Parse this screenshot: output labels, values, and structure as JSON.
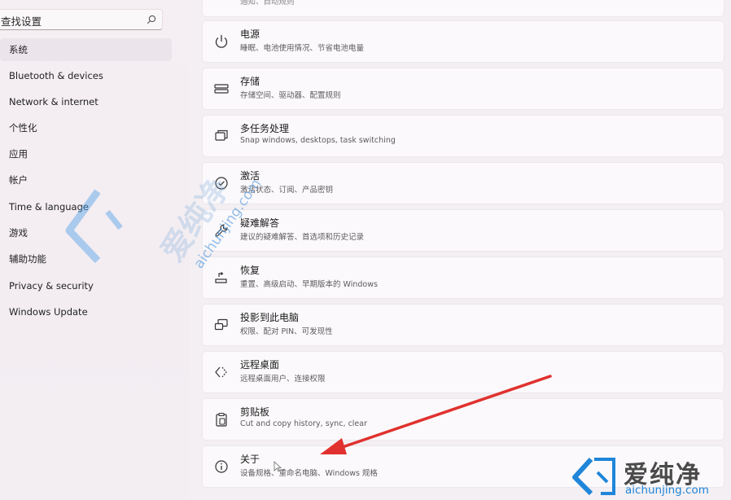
{
  "search": {
    "placeholder": "查找设置"
  },
  "sidebar": {
    "items": [
      {
        "label": "系统",
        "active": true
      },
      {
        "label": "Bluetooth & devices"
      },
      {
        "label": "Network & internet"
      },
      {
        "label": "个性化"
      },
      {
        "label": "应用"
      },
      {
        "label": "帐户"
      },
      {
        "label": "Time & language"
      },
      {
        "label": "游戏"
      },
      {
        "label": "辅助功能"
      },
      {
        "label": "Privacy & security"
      },
      {
        "label": "Windows Update"
      }
    ]
  },
  "main": {
    "top_partial": {
      "desc": "通知、自动规则"
    },
    "cards": [
      {
        "icon": "power-icon",
        "title": "电源",
        "desc": "睡眠、电池使用情况、节省电池电量"
      },
      {
        "icon": "storage-icon",
        "title": "存储",
        "desc": "存储空间、驱动器、配置规则"
      },
      {
        "icon": "multitasking-icon",
        "title": "多任务处理",
        "desc": "Snap windows, desktops, task switching"
      },
      {
        "icon": "activation-icon",
        "title": "激活",
        "desc": "激活状态、订阅、产品密钥"
      },
      {
        "icon": "troubleshoot-icon",
        "title": "疑难解答",
        "desc": "建议的疑难解答、首选项和历史记录"
      },
      {
        "icon": "recovery-icon",
        "title": "恢复",
        "desc": "重置、高级启动、早期版本的 Windows"
      },
      {
        "icon": "project-icon",
        "title": "投影到此电脑",
        "desc": "权限、配对 PIN、可发现性"
      },
      {
        "icon": "remote-desktop-icon",
        "title": "远程桌面",
        "desc": "远程桌面用户、连接权限"
      },
      {
        "icon": "clipboard-icon",
        "title": "剪贴板",
        "desc": "Cut and copy history, sync, clear"
      },
      {
        "icon": "info-icon",
        "title": "关于",
        "desc": "设备规格、重命名电脑、Windows 规格"
      }
    ]
  },
  "watermark": {
    "big": "爱纯净",
    "url": "aichunjing.com"
  },
  "brand": {
    "name": "爱纯净",
    "url": "aichunjing.com"
  },
  "colors": {
    "arrow": "#e0312e",
    "brand_blue": "#1f86d9"
  }
}
